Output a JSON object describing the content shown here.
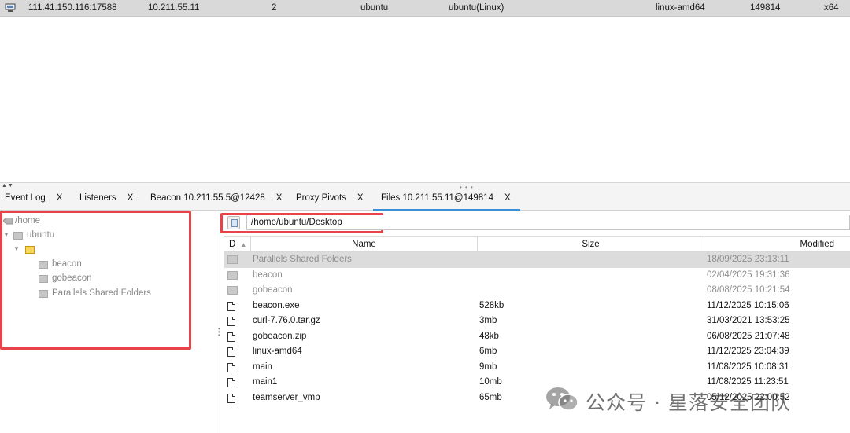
{
  "session": {
    "external": "111.41.150.116:17588",
    "internal": "10.211.55.11",
    "pid_col": "2",
    "user": "ubuntu",
    "computer": "ubuntu(Linux)",
    "process": "linux-amd64",
    "pid": "149814",
    "arch": "x64"
  },
  "tabs": [
    {
      "label": "Event Log",
      "close": "X"
    },
    {
      "label": "Listeners",
      "close": "X"
    },
    {
      "label": "Beacon 10.211.55.5@12428",
      "close": "X"
    },
    {
      "label": "Proxy Pivots",
      "close": "X"
    },
    {
      "label": "Files 10.211.55.11@149814",
      "close": "X"
    }
  ],
  "tree": {
    "root": "/home",
    "user": "ubuntu",
    "children": [
      "beacon",
      "gobeacon",
      "Parallels Shared Folders"
    ]
  },
  "path": {
    "value": "/home/ubuntu/Desktop"
  },
  "columns": {
    "d": "D",
    "name": "Name",
    "size": "Size",
    "modified": "Modified"
  },
  "files": [
    {
      "type": "dir",
      "name": "Parallels Shared Folders",
      "size": "",
      "modified": "18/09/2025 23:13:11"
    },
    {
      "type": "dir",
      "name": "beacon",
      "size": "",
      "modified": "02/04/2025 19:31:36"
    },
    {
      "type": "dir",
      "name": "gobeacon",
      "size": "",
      "modified": "08/08/2025 10:21:54"
    },
    {
      "type": "file",
      "name": "beacon.exe",
      "size": "528kb",
      "modified": "11/12/2025 10:15:06"
    },
    {
      "type": "file",
      "name": "curl-7.76.0.tar.gz",
      "size": "3mb",
      "modified": "31/03/2021 13:53:25"
    },
    {
      "type": "file",
      "name": "gobeacon.zip",
      "size": "48kb",
      "modified": "06/08/2025 21:07:48"
    },
    {
      "type": "file",
      "name": "linux-amd64",
      "size": "6mb",
      "modified": "11/12/2025 23:04:39"
    },
    {
      "type": "file",
      "name": "main",
      "size": "9mb",
      "modified": "11/08/2025 10:08:31"
    },
    {
      "type": "file",
      "name": "main1",
      "size": "10mb",
      "modified": "11/08/2025 11:23:51"
    },
    {
      "type": "file",
      "name": "teamserver_vmp",
      "size": "65mb",
      "modified": "05/12/2025 22:00:52"
    }
  ],
  "watermark": {
    "text": "公众号 · 星落安全团队"
  },
  "colors": {
    "highlight": "#e8434b",
    "active_tab": "#3b8fd9",
    "row_selected": "#dcdcdc"
  }
}
